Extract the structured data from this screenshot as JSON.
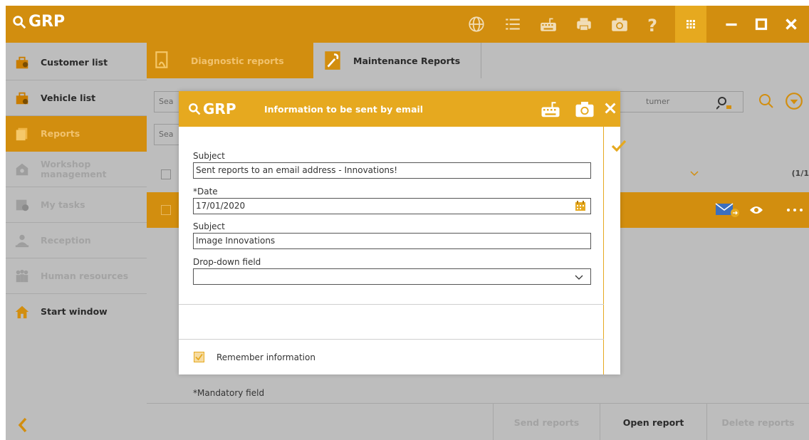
{
  "colors": {
    "accent": "#d28e0f",
    "modal_accent": "#e6a91f",
    "panel_bg": "#bdbdbd"
  },
  "app": {
    "title": "GRP"
  },
  "titlebar": {
    "icons": [
      "globe-icon",
      "list-icon",
      "keyboard-icon",
      "printer-icon",
      "camera-icon",
      "help-icon",
      "apps-grid-icon",
      "minimize-icon",
      "maximize-icon",
      "close-icon"
    ]
  },
  "sidebar": {
    "items": [
      {
        "label": "Customer list",
        "icon": "customer-icon",
        "state": "enabled"
      },
      {
        "label": "Vehicle list",
        "icon": "vehicle-icon",
        "state": "enabled"
      },
      {
        "label": "Reports",
        "icon": "reports-icon",
        "state": "active"
      },
      {
        "label": "Workshop management",
        "icon": "workshop-icon",
        "state": "disabled"
      },
      {
        "label": "My tasks",
        "icon": "tasks-icon",
        "state": "disabled"
      },
      {
        "label": "Reception",
        "icon": "reception-icon",
        "state": "disabled"
      },
      {
        "label": "Human resources",
        "icon": "human-resources-icon",
        "state": "disabled"
      },
      {
        "label": "Start window",
        "icon": "home-icon",
        "state": "enabled"
      }
    ]
  },
  "tabs": [
    {
      "label": "Diagnostic reports",
      "active": true
    },
    {
      "label": "Maintenance Reports",
      "active": false
    }
  ],
  "search": {
    "field1": "Sea",
    "field2": "Sea",
    "customer_placeholder": "tumer"
  },
  "list": {
    "pager": "(1/1"
  },
  "bottom_bar": {
    "send": "Send reports",
    "open": "Open report",
    "delete": "Delete reports"
  },
  "modal": {
    "logo": "GRP",
    "title": "Information to be sent by email",
    "subject_label": "Subject",
    "subject_value": "Sent reports to an email address - Innovations!",
    "date_label": "*Date",
    "date_value": "17/01/2020",
    "subject2_label": "Subject",
    "subject2_value": "Image Innovations",
    "dropdown_label": "Drop-down field",
    "dropdown_value": "",
    "remember_label": "Remember information",
    "remember_checked": true,
    "mandatory_note": "*Mandatory field"
  }
}
